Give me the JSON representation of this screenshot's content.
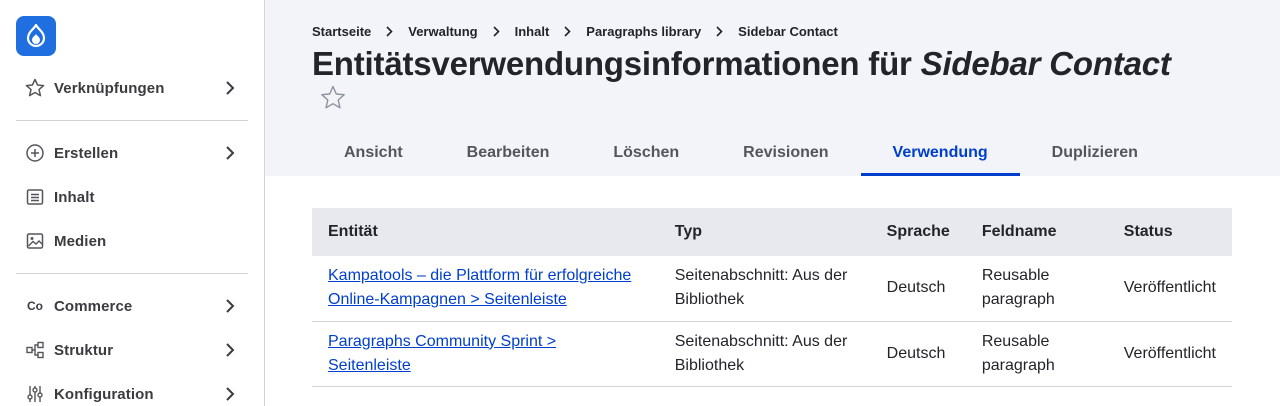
{
  "sidebar": {
    "items": [
      {
        "label": "Verknüpfungen",
        "icon": "star-outline-icon"
      },
      {
        "label": "Erstellen",
        "icon": "plus-circle-icon"
      },
      {
        "label": "Inhalt",
        "icon": "content-list-icon"
      },
      {
        "label": "Medien",
        "icon": "image-icon"
      },
      {
        "label": "Commerce",
        "icon": "co-text-icon",
        "icon_text": "Co"
      },
      {
        "label": "Struktur",
        "icon": "structure-icon"
      },
      {
        "label": "Konfiguration",
        "icon": "sliders-icon"
      }
    ]
  },
  "breadcrumb": [
    "Startseite",
    "Verwaltung",
    "Inhalt",
    "Paragraphs library",
    "Sidebar Contact"
  ],
  "page": {
    "title_prefix": "Entitätsverwendungsinformationen für ",
    "title_entity": "Sidebar Contact"
  },
  "tabs": [
    "Ansicht",
    "Bearbeiten",
    "Löschen",
    "Revisionen",
    "Verwendung",
    "Duplizieren"
  ],
  "active_tab": "Verwendung",
  "table": {
    "headers": [
      "Entität",
      "Typ",
      "Sprache",
      "Feldname",
      "Status"
    ],
    "rows": [
      {
        "entity": "Kampatools – die Plattform für erfolgreiche Online-Kampagnen > Seitenleiste",
        "type": "Seitenabschnitt: Aus der Bibliothek",
        "language": "Deutsch",
        "field": "Reusable paragraph",
        "status": "Veröffentlicht"
      },
      {
        "entity": "Paragraphs Community Sprint > Seitenleiste",
        "type": "Seitenabschnitt: Aus der Bibliothek",
        "language": "Deutsch",
        "field": "Reusable paragraph",
        "status": "Veröffentlicht"
      }
    ]
  },
  "colors": {
    "accent": "#003ecc",
    "logo": "#1f6fe0",
    "header_bg": "#f3f4f9",
    "table_header_bg": "#e8e9ef"
  }
}
